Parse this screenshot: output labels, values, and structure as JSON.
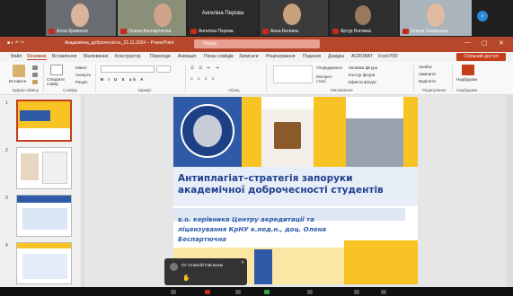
{
  "participants": [
    {
      "name": "Алла Кривонос"
    },
    {
      "name": "Олена Беспартючна"
    },
    {
      "name": "Ангеліна Перова",
      "avatar_name": "Ангеліна Перова"
    },
    {
      "name": "Анна Бегвинь"
    },
    {
      "name": "Артур Богомаз"
    },
    {
      "name": "Олена Гіковитина"
    }
  ],
  "app": {
    "title": "Академічна_доброчесність_21.11.2024 – PowerPoint",
    "search_placeholder": "Пошук",
    "controls": [
      "—",
      "▢",
      "✕"
    ]
  },
  "menu": {
    "tabs": [
      "Файл",
      "Основне",
      "Вставлення",
      "Малювання",
      "Конструктор",
      "Переходи",
      "Анімація",
      "Показ слайдів",
      "Записати",
      "Рецензування",
      "Подання",
      "Довідка",
      "ACROBAT",
      "Foxit PDF"
    ],
    "active": "Основне",
    "share_label": "Спільний доступ"
  },
  "ribbon": {
    "groups": [
      "Буфер обміну",
      "Слайди",
      "Шрифт",
      "Абзац",
      "Малювання",
      "Редагування",
      "Надбудови"
    ],
    "buttons": {
      "paste": "Вставити",
      "new_slide": "Створити слайд",
      "layout": "Макет",
      "reset": "Скинути",
      "section": "Розділ",
      "arrange": "Упорядкувати",
      "quick_styles": "Експрес-стилі",
      "fill": "Заливка фігури",
      "outline": "Контур фігури",
      "effects": "Ефекти фігури",
      "find": "Знайти",
      "replace": "Замінити",
      "select": "Виділити",
      "addins": "Надбудови"
    }
  },
  "thumbnails": [
    "1",
    "2",
    "3",
    "4"
  ],
  "slide": {
    "title": "Антиплагіат–стратегія запоруки академічної доброчесності студентів",
    "subtitle": "в.о. керівника Центру акредитації та ліцензування КрНУ к.пед.н., доц. Олена Беспартючна"
  },
  "toast": {
    "text": "От Олексій Гай всем",
    "close": "✕"
  },
  "colors": {
    "accent": "#b7472a",
    "share": "#c43e1c",
    "slide_blue": "#1f3f8f",
    "slide_yellow": "#f7c325"
  }
}
